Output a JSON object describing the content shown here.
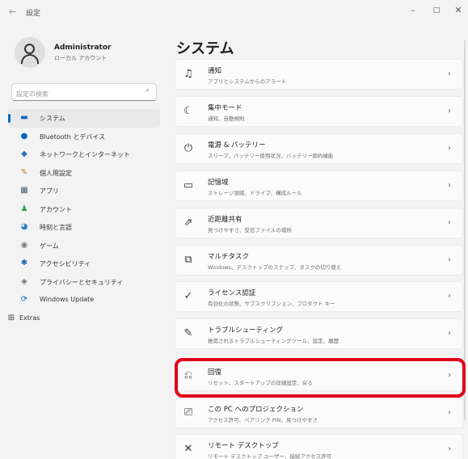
{
  "window": {
    "back_glyph": "←",
    "title": "設定",
    "minimize_glyph": "–",
    "maximize_glyph": "□",
    "close_glyph": "✕"
  },
  "profile": {
    "name": "Administrator",
    "account_type": "ローカル アカウント"
  },
  "search": {
    "placeholder": "設定の検索",
    "icon": "search-icon",
    "icon_glyph": "⌕"
  },
  "nav": {
    "items": [
      {
        "label": "システム",
        "icon": "system-icon",
        "glyph": "▬",
        "color": "#0067c0",
        "active": true
      },
      {
        "label": "Bluetooth とデバイス",
        "icon": "bluetooth-icon",
        "glyph": "●",
        "color": "#0a64c2"
      },
      {
        "label": "ネットワークとインターネット",
        "icon": "network-icon",
        "glyph": "◆",
        "color": "#2a6db8"
      },
      {
        "label": "個人用設定",
        "icon": "personalization-icon",
        "glyph": "✎",
        "color": "#c47a2a"
      },
      {
        "label": "アプリ",
        "icon": "apps-icon",
        "glyph": "▦",
        "color": "#4a5a6a"
      },
      {
        "label": "アカウント",
        "icon": "accounts-icon",
        "glyph": "♟",
        "color": "#2f9e63"
      },
      {
        "label": "時刻と言語",
        "icon": "time-language-icon",
        "glyph": "◕",
        "color": "#2a7fc9"
      },
      {
        "label": "ゲーム",
        "icon": "gaming-icon",
        "glyph": "◉",
        "color": "#7a7a7a"
      },
      {
        "label": "アクセシビリティ",
        "icon": "accessibility-icon",
        "glyph": "✱",
        "color": "#1c5fb8"
      },
      {
        "label": "プライバシーとセキュリティ",
        "icon": "privacy-icon",
        "glyph": "◈",
        "color": "#6b6b6b"
      },
      {
        "label": "Windows Update",
        "icon": "windows-update-icon",
        "glyph": "⟳",
        "color": "#0a64c2"
      }
    ],
    "extras": {
      "label": "Extras",
      "icon": "extras-icon",
      "glyph": "⊞",
      "color": "#444"
    }
  },
  "main": {
    "title": "システム",
    "chevron_glyph": "›",
    "cards": [
      {
        "title": "通知",
        "subtitle": "アプリとシステムからのアラート",
        "icon": "bell-icon",
        "glyph": "♫"
      },
      {
        "title": "集中モード",
        "subtitle": "通知、自動規則",
        "icon": "focus-icon",
        "glyph": "☾"
      },
      {
        "title": "電源 & バッテリー",
        "subtitle": "スリープ、バッテリー使用状況、バッテリー節約機能",
        "icon": "power-icon",
        "glyph": "⏻"
      },
      {
        "title": "記憶域",
        "subtitle": "ストレージ領域、ドライブ、構成ルール",
        "icon": "storage-icon",
        "glyph": "▭"
      },
      {
        "title": "近距離共有",
        "subtitle": "見つけやすさ、受信ファイルの場所",
        "icon": "nearby-sharing-icon",
        "glyph": "⇗"
      },
      {
        "title": "マルチタスク",
        "subtitle": "Windows、デスクトップのスナップ、タスクの切り替え",
        "icon": "multitasking-icon",
        "glyph": "⧉"
      },
      {
        "title": "ライセンス認証",
        "subtitle": "有効化の状態、サブスクリプション、プロダクト キー",
        "icon": "activation-icon",
        "glyph": "✓"
      },
      {
        "title": "トラブルシューティング",
        "subtitle": "推奨されるトラブルシューティングツール、設定、履歴",
        "icon": "troubleshoot-icon",
        "glyph": "✎"
      },
      {
        "title": "回復",
        "subtitle": "リセット、スタートアップの詳細設定、戻る",
        "icon": "recovery-icon",
        "glyph": "⎌",
        "highlighted": true
      },
      {
        "title": "この PC へのプロジェクション",
        "subtitle": "アクセス許可、ペアリング PIN、見つけやすさ",
        "icon": "projection-icon",
        "glyph": "⎚"
      },
      {
        "title": "リモート デスクトップ",
        "subtitle": "リモート デスクトップ ユーザー、接続アクセス許可",
        "icon": "remote-desktop-icon",
        "glyph": "✕"
      }
    ]
  },
  "annotation": {
    "color": "#e0001a"
  }
}
